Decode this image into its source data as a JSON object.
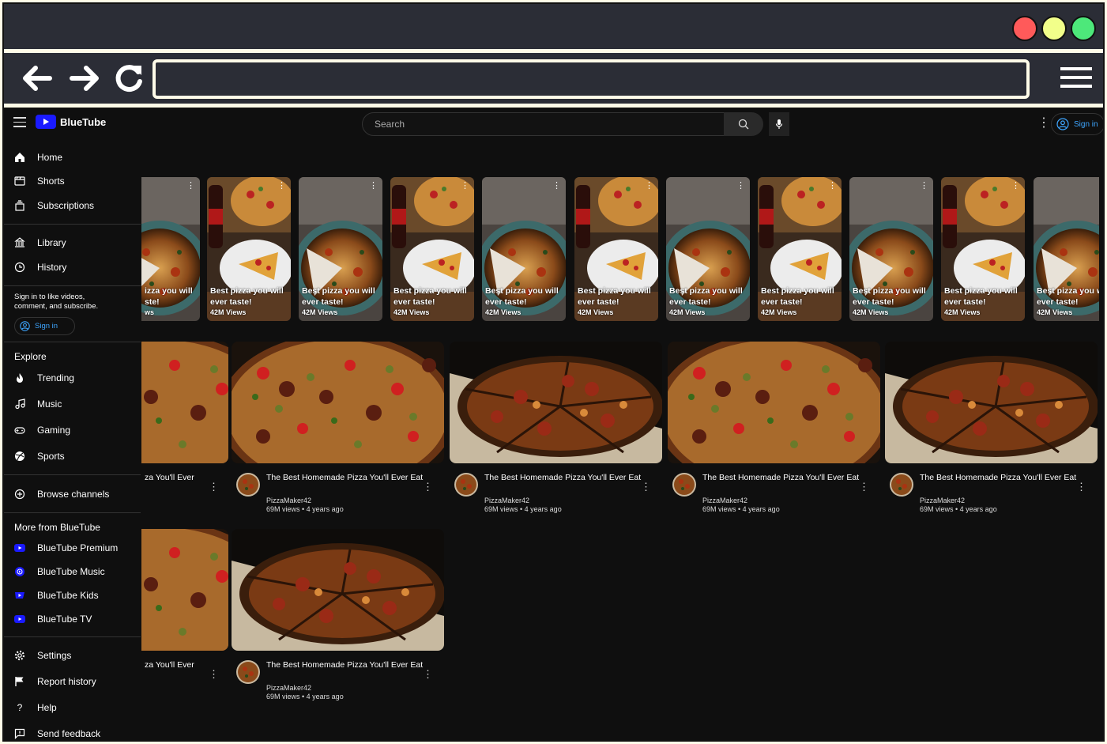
{
  "browser": {
    "window_dots": [
      "#ff5a5a",
      "#f2ff8a",
      "#4de87a"
    ],
    "url_value": ""
  },
  "app": {
    "brand": "BlueTube",
    "search_placeholder": "Search",
    "signin_label": "Sign in"
  },
  "sidebar": {
    "main": [
      {
        "label": "Home",
        "icon": "home-icon"
      },
      {
        "label": "Shorts",
        "icon": "shorts-icon"
      },
      {
        "label": "Subscriptions",
        "icon": "subscriptions-icon"
      }
    ],
    "library": [
      {
        "label": "Library",
        "icon": "library-icon"
      },
      {
        "label": "History",
        "icon": "history-icon"
      }
    ],
    "signin_note": "Sign in to like videos, comment, and subscribe.",
    "signin_label": "Sign in",
    "explore_heading": "Explore",
    "explore": [
      {
        "label": "Trending",
        "icon": "trending-icon"
      },
      {
        "label": "Music",
        "icon": "music-icon"
      },
      {
        "label": "Gaming",
        "icon": "gaming-icon"
      },
      {
        "label": "Sports",
        "icon": "sports-icon"
      }
    ],
    "browse_channels": "Browse channels",
    "more_heading": "More from BlueTube",
    "more": [
      {
        "label": "BlueTube Premium",
        "icon": "premium-icon"
      },
      {
        "label": "BlueTube Music",
        "icon": "music-app-icon"
      },
      {
        "label": "BlueTube Kids",
        "icon": "kids-icon"
      },
      {
        "label": "BlueTube TV",
        "icon": "tv-icon"
      }
    ],
    "footer": [
      {
        "label": "Settings",
        "icon": "gear-icon"
      },
      {
        "label": "Report history",
        "icon": "flag-icon"
      },
      {
        "label": "Help",
        "icon": "help-icon"
      },
      {
        "label": "Send feedback",
        "icon": "feedback-icon"
      }
    ]
  },
  "shorts": {
    "title_line1": "Best pizza you will",
    "title_line2": "ever taste!",
    "views": "42M Views",
    "partial_first": {
      "line1": "izza you will",
      "line2": "ste!",
      "views": "ws"
    },
    "partial_last": {
      "line1": "Best pizza you w",
      "line2": "ever taste!",
      "views": "42M Views"
    }
  },
  "videos": {
    "title": "The Best Homemade Pizza You'll Ever Eat",
    "partial_title": "za You'll Ever",
    "channel": "PizzaMaker42",
    "views": "69M views",
    "age": "4 years ago"
  }
}
